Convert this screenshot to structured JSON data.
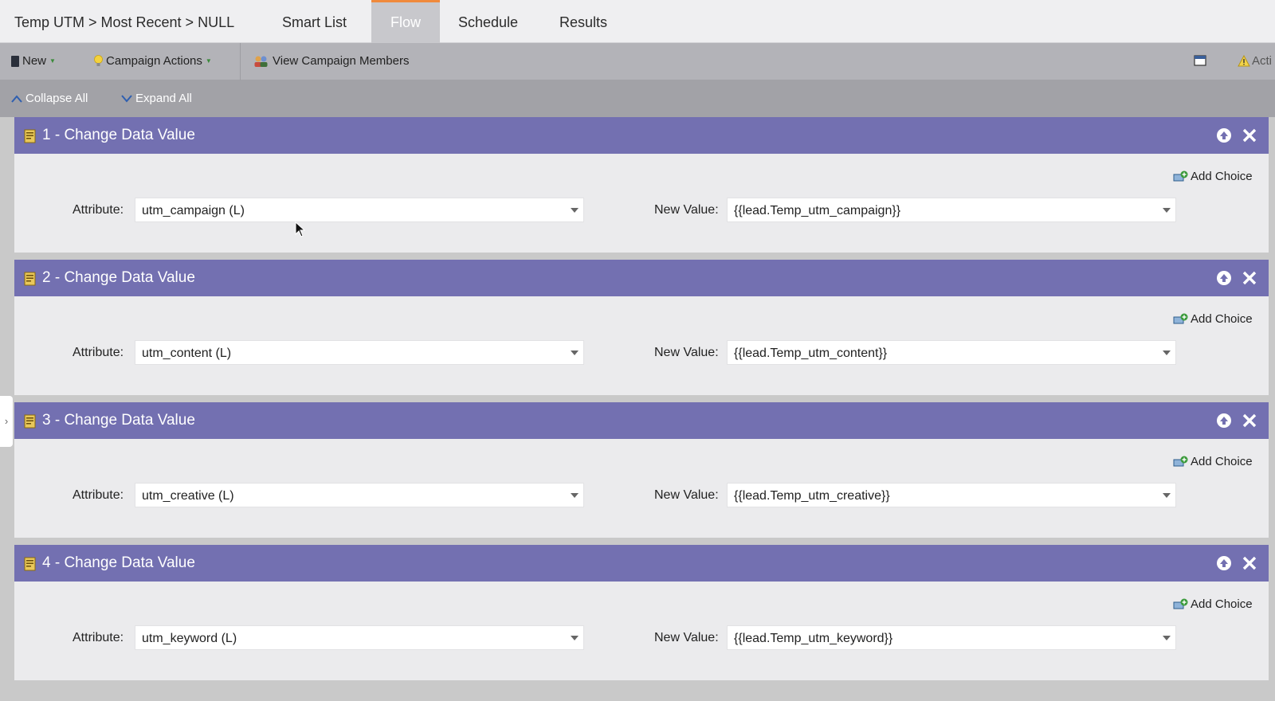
{
  "tabs": {
    "breadcrumb": "Temp UTM > Most Recent > NULL",
    "items": [
      {
        "label": "Smart List",
        "active": false
      },
      {
        "label": "Flow",
        "active": true
      },
      {
        "label": "Schedule",
        "active": false
      },
      {
        "label": "Results",
        "active": false
      }
    ]
  },
  "toolbar": {
    "new_label": "New",
    "campaign_actions_label": "Campaign Actions",
    "view_members_label": "View Campaign Members",
    "alert_label": "Acti"
  },
  "flow_controls": {
    "collapse_label": "Collapse All",
    "expand_label": "Expand All"
  },
  "steps": [
    {
      "title": "1 - Change Data Value",
      "attribute_label": "Attribute:",
      "attribute_value": "utm_campaign (L)",
      "new_value_label": "New Value:",
      "new_value": "{{lead.Temp_utm_campaign}}",
      "add_choice_label": "Add Choice"
    },
    {
      "title": "2 - Change Data Value",
      "attribute_label": "Attribute:",
      "attribute_value": "utm_content (L)",
      "new_value_label": "New Value:",
      "new_value": "{{lead.Temp_utm_content}}",
      "add_choice_label": "Add Choice"
    },
    {
      "title": "3 - Change Data Value",
      "attribute_label": "Attribute:",
      "attribute_value": "utm_creative (L)",
      "new_value_label": "New Value:",
      "new_value": "{{lead.Temp_utm_creative}}",
      "add_choice_label": "Add Choice"
    },
    {
      "title": "4 - Change Data Value",
      "attribute_label": "Attribute:",
      "attribute_value": "utm_keyword (L)",
      "new_value_label": "New Value:",
      "new_value": "{{lead.Temp_utm_keyword}}",
      "add_choice_label": "Add Choice"
    }
  ],
  "colors": {
    "step_header": "#7370b1",
    "active_tab_accent": "#f08a3c",
    "toolbar_bg": "#b3b3b8"
  }
}
